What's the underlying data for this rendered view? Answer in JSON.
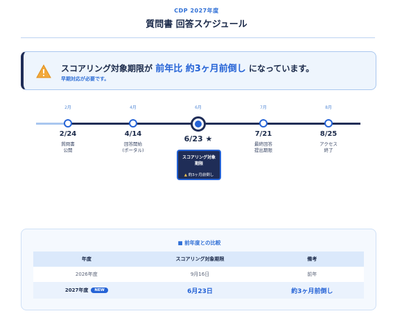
{
  "header": {
    "eyebrow": "CDP 2027年度",
    "title": "質問書 回答スケジュール"
  },
  "alert": {
    "icon": "warning-icon",
    "text_before": "スコアリング対象期限が ",
    "highlight": "前年比 約3ヶ月前倒し",
    "text_after": " になっています。",
    "sub": "早期対応が必要です。"
  },
  "timeline": [
    {
      "month": "2月",
      "date": "2/24",
      "label_line1": "質問書",
      "label_line2": "公開"
    },
    {
      "month": "4月",
      "date": "4/14",
      "label_line1": "回答開始",
      "label_line2": "(ポータル)"
    },
    {
      "month": "6月",
      "date": "6/23 ★",
      "label_line1": "",
      "label_line2": ""
    },
    {
      "month": "7月",
      "date": "7/21",
      "label_line1": "最終回答",
      "label_line2": "提出期限"
    },
    {
      "month": "8月",
      "date": "8/25",
      "label_line1": "アクセス",
      "label_line2": "終了"
    }
  ],
  "callout": {
    "line1": "スコアリング対象",
    "line2": "期限",
    "note": "約3ヶ月前倒し"
  },
  "comparison": {
    "heading": "■ 前年度との比較",
    "columns": [
      "年度",
      "スコアリング対象期限",
      "備考"
    ],
    "rows": [
      {
        "year": "2026年度",
        "deadline": "9月16日",
        "note": "前年"
      },
      {
        "year": "2027年度",
        "badge": "NEW",
        "deadline": "6月23日",
        "note": "約3ヶ月前倒し"
      }
    ]
  },
  "colors": {
    "accent": "#2563d6",
    "navy": "#1f2d57",
    "warning": "#f2a93b"
  }
}
